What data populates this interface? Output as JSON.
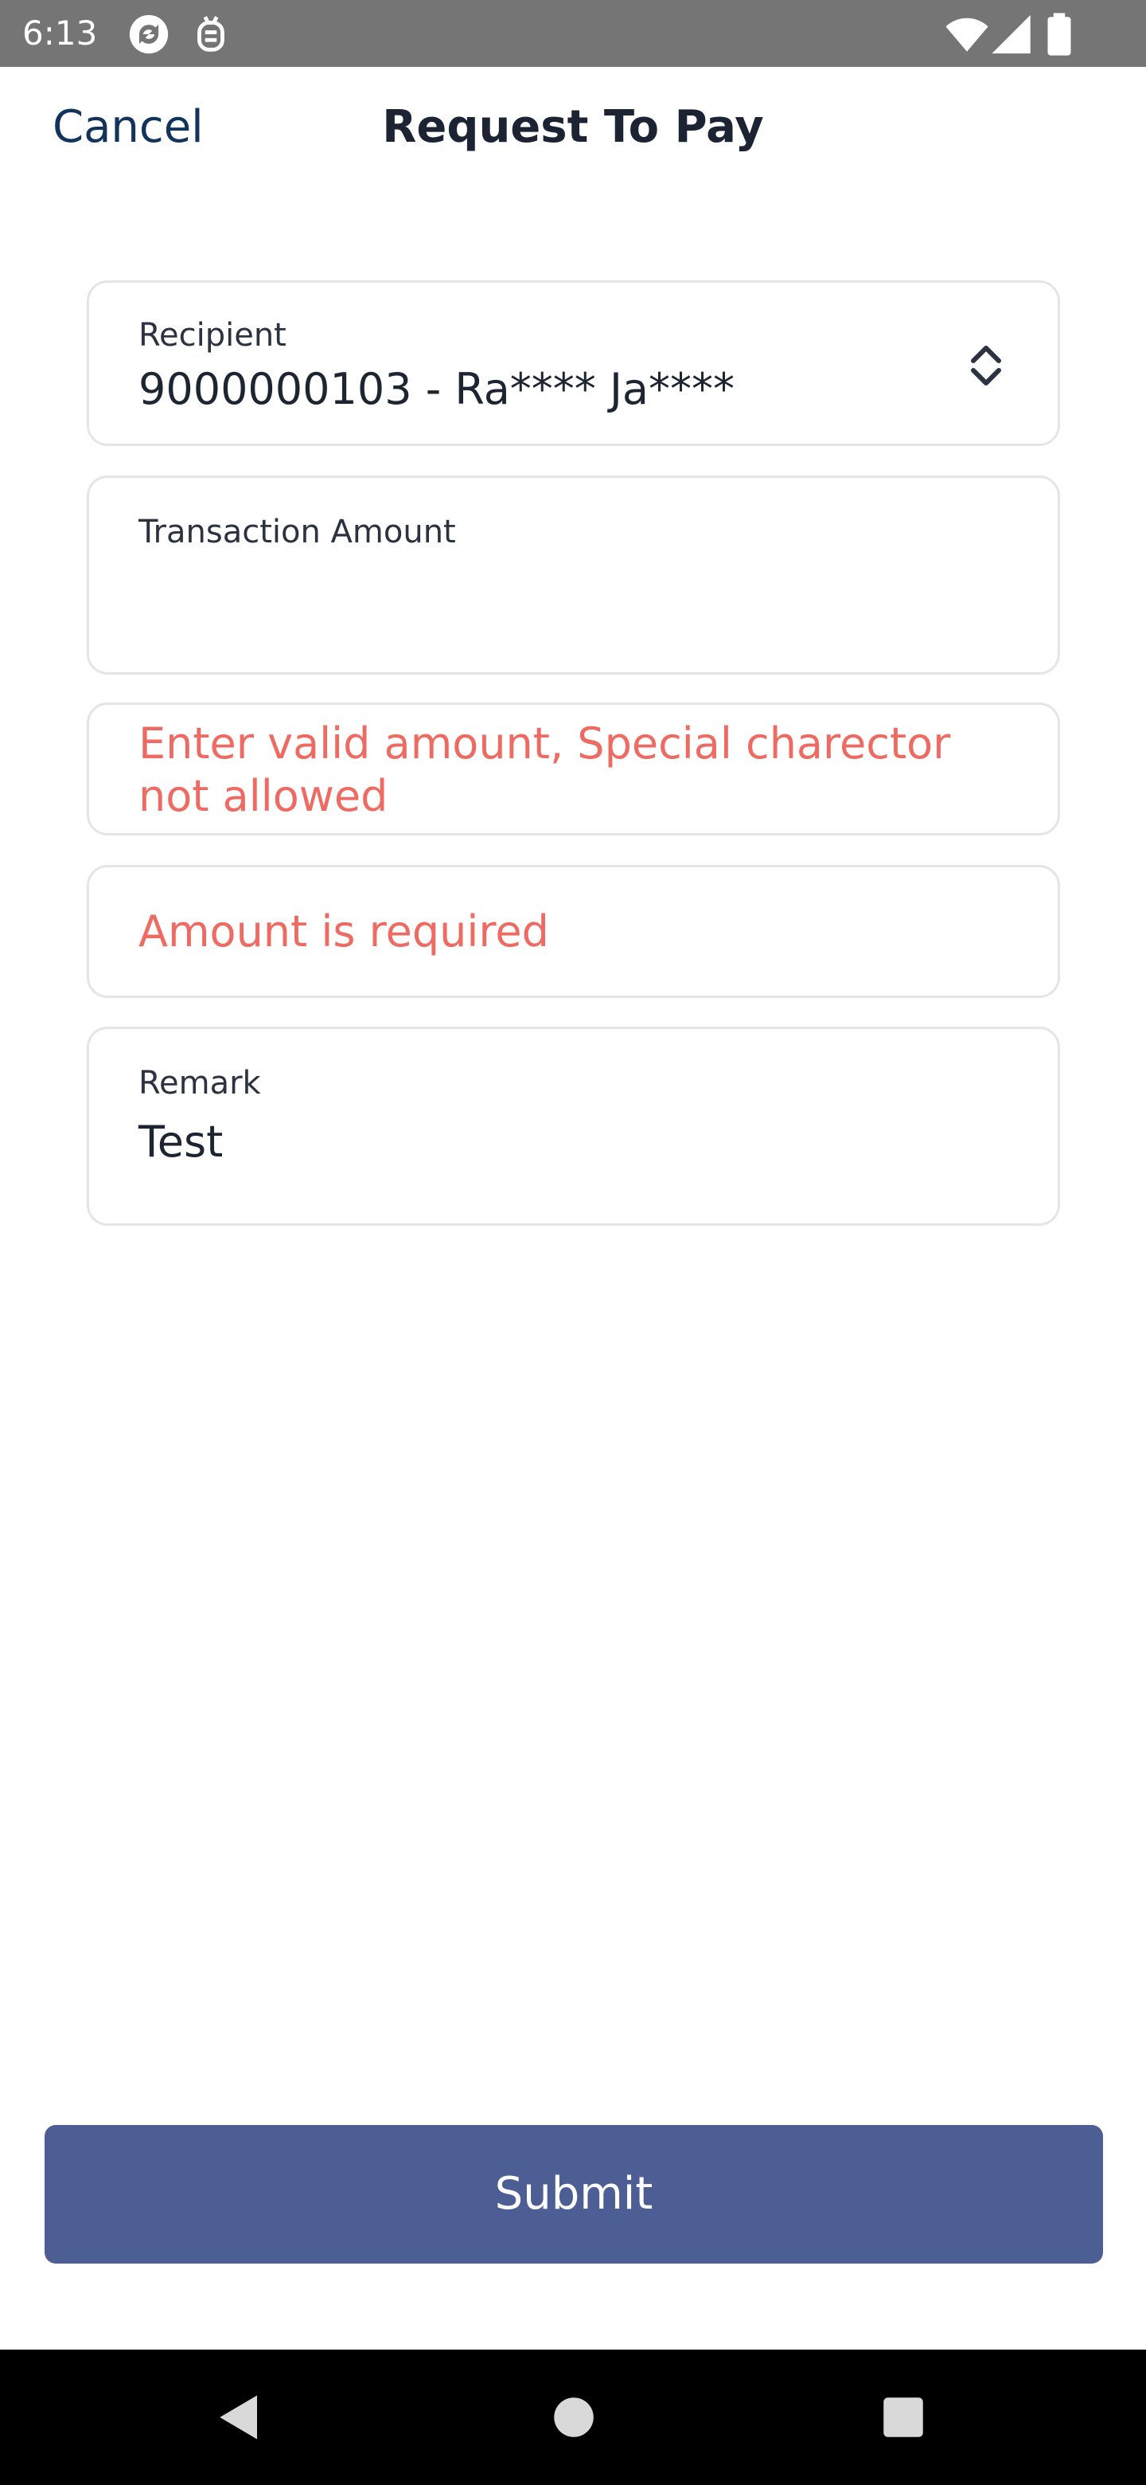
{
  "status_bar": {
    "time": "6:13",
    "left_icons": [
      "sync-app-icon",
      "notification-app-icon"
    ],
    "right_icons": [
      "wifi-icon",
      "signal-icon",
      "battery-icon"
    ]
  },
  "header": {
    "cancel_label": "Cancel",
    "title": "Request To Pay"
  },
  "form": {
    "recipient": {
      "label": "Recipient",
      "value": "9000000103 - Ra**** Ja****",
      "icon": "chevron-up-down-icon"
    },
    "amount": {
      "label": "Transaction Amount",
      "value": ""
    },
    "errors": [
      "Enter valid amount, Special charector not allowed",
      "Amount is required"
    ],
    "remark": {
      "label": "Remark",
      "value": "Test"
    },
    "submit_label": "Submit"
  },
  "nav_bar": {
    "buttons": [
      "back-icon",
      "home-icon",
      "recents-icon"
    ]
  },
  "colors": {
    "primary_button": "#4d5e95",
    "error_text": "#ee6b63",
    "link_text": "#12335c",
    "status_bar": "#757575",
    "nav_bar": "#000000"
  }
}
